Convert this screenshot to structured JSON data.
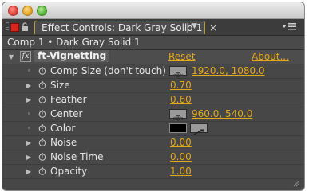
{
  "window": {
    "tab_title": "Effect Controls: Dark Gray Solid 1",
    "tab_close_glyph": "×",
    "menu_glyph": "≡"
  },
  "breadcrumb": "Comp 1 • Dark Gray Solid 1",
  "effect": {
    "icon_label": "fx",
    "name": "ft-Vignetting",
    "reset_label": "Reset",
    "about_label": "About..."
  },
  "params": [
    {
      "name": "Comp Size (don't touch)",
      "value": "1920.0, 1080.0",
      "expandable": false,
      "control": "point"
    },
    {
      "name": "Size",
      "value": "0.70",
      "expandable": true
    },
    {
      "name": "Feather",
      "value": "0.60",
      "expandable": true
    },
    {
      "name": "Center",
      "value": "960.0, 540.0",
      "expandable": false,
      "control": "point"
    },
    {
      "name": "Color",
      "value": "",
      "expandable": false,
      "control": "color",
      "color": "#000000"
    },
    {
      "name": "Noise",
      "value": "0.00",
      "expandable": true
    },
    {
      "name": "Noise Time",
      "value": "0.00",
      "expandable": true
    },
    {
      "name": "Opacity",
      "value": "1.00",
      "expandable": true
    }
  ],
  "colors": {
    "accent_value": "#e3a81b",
    "panel_bg": "#474747",
    "tab_outline": "#b8a030"
  }
}
